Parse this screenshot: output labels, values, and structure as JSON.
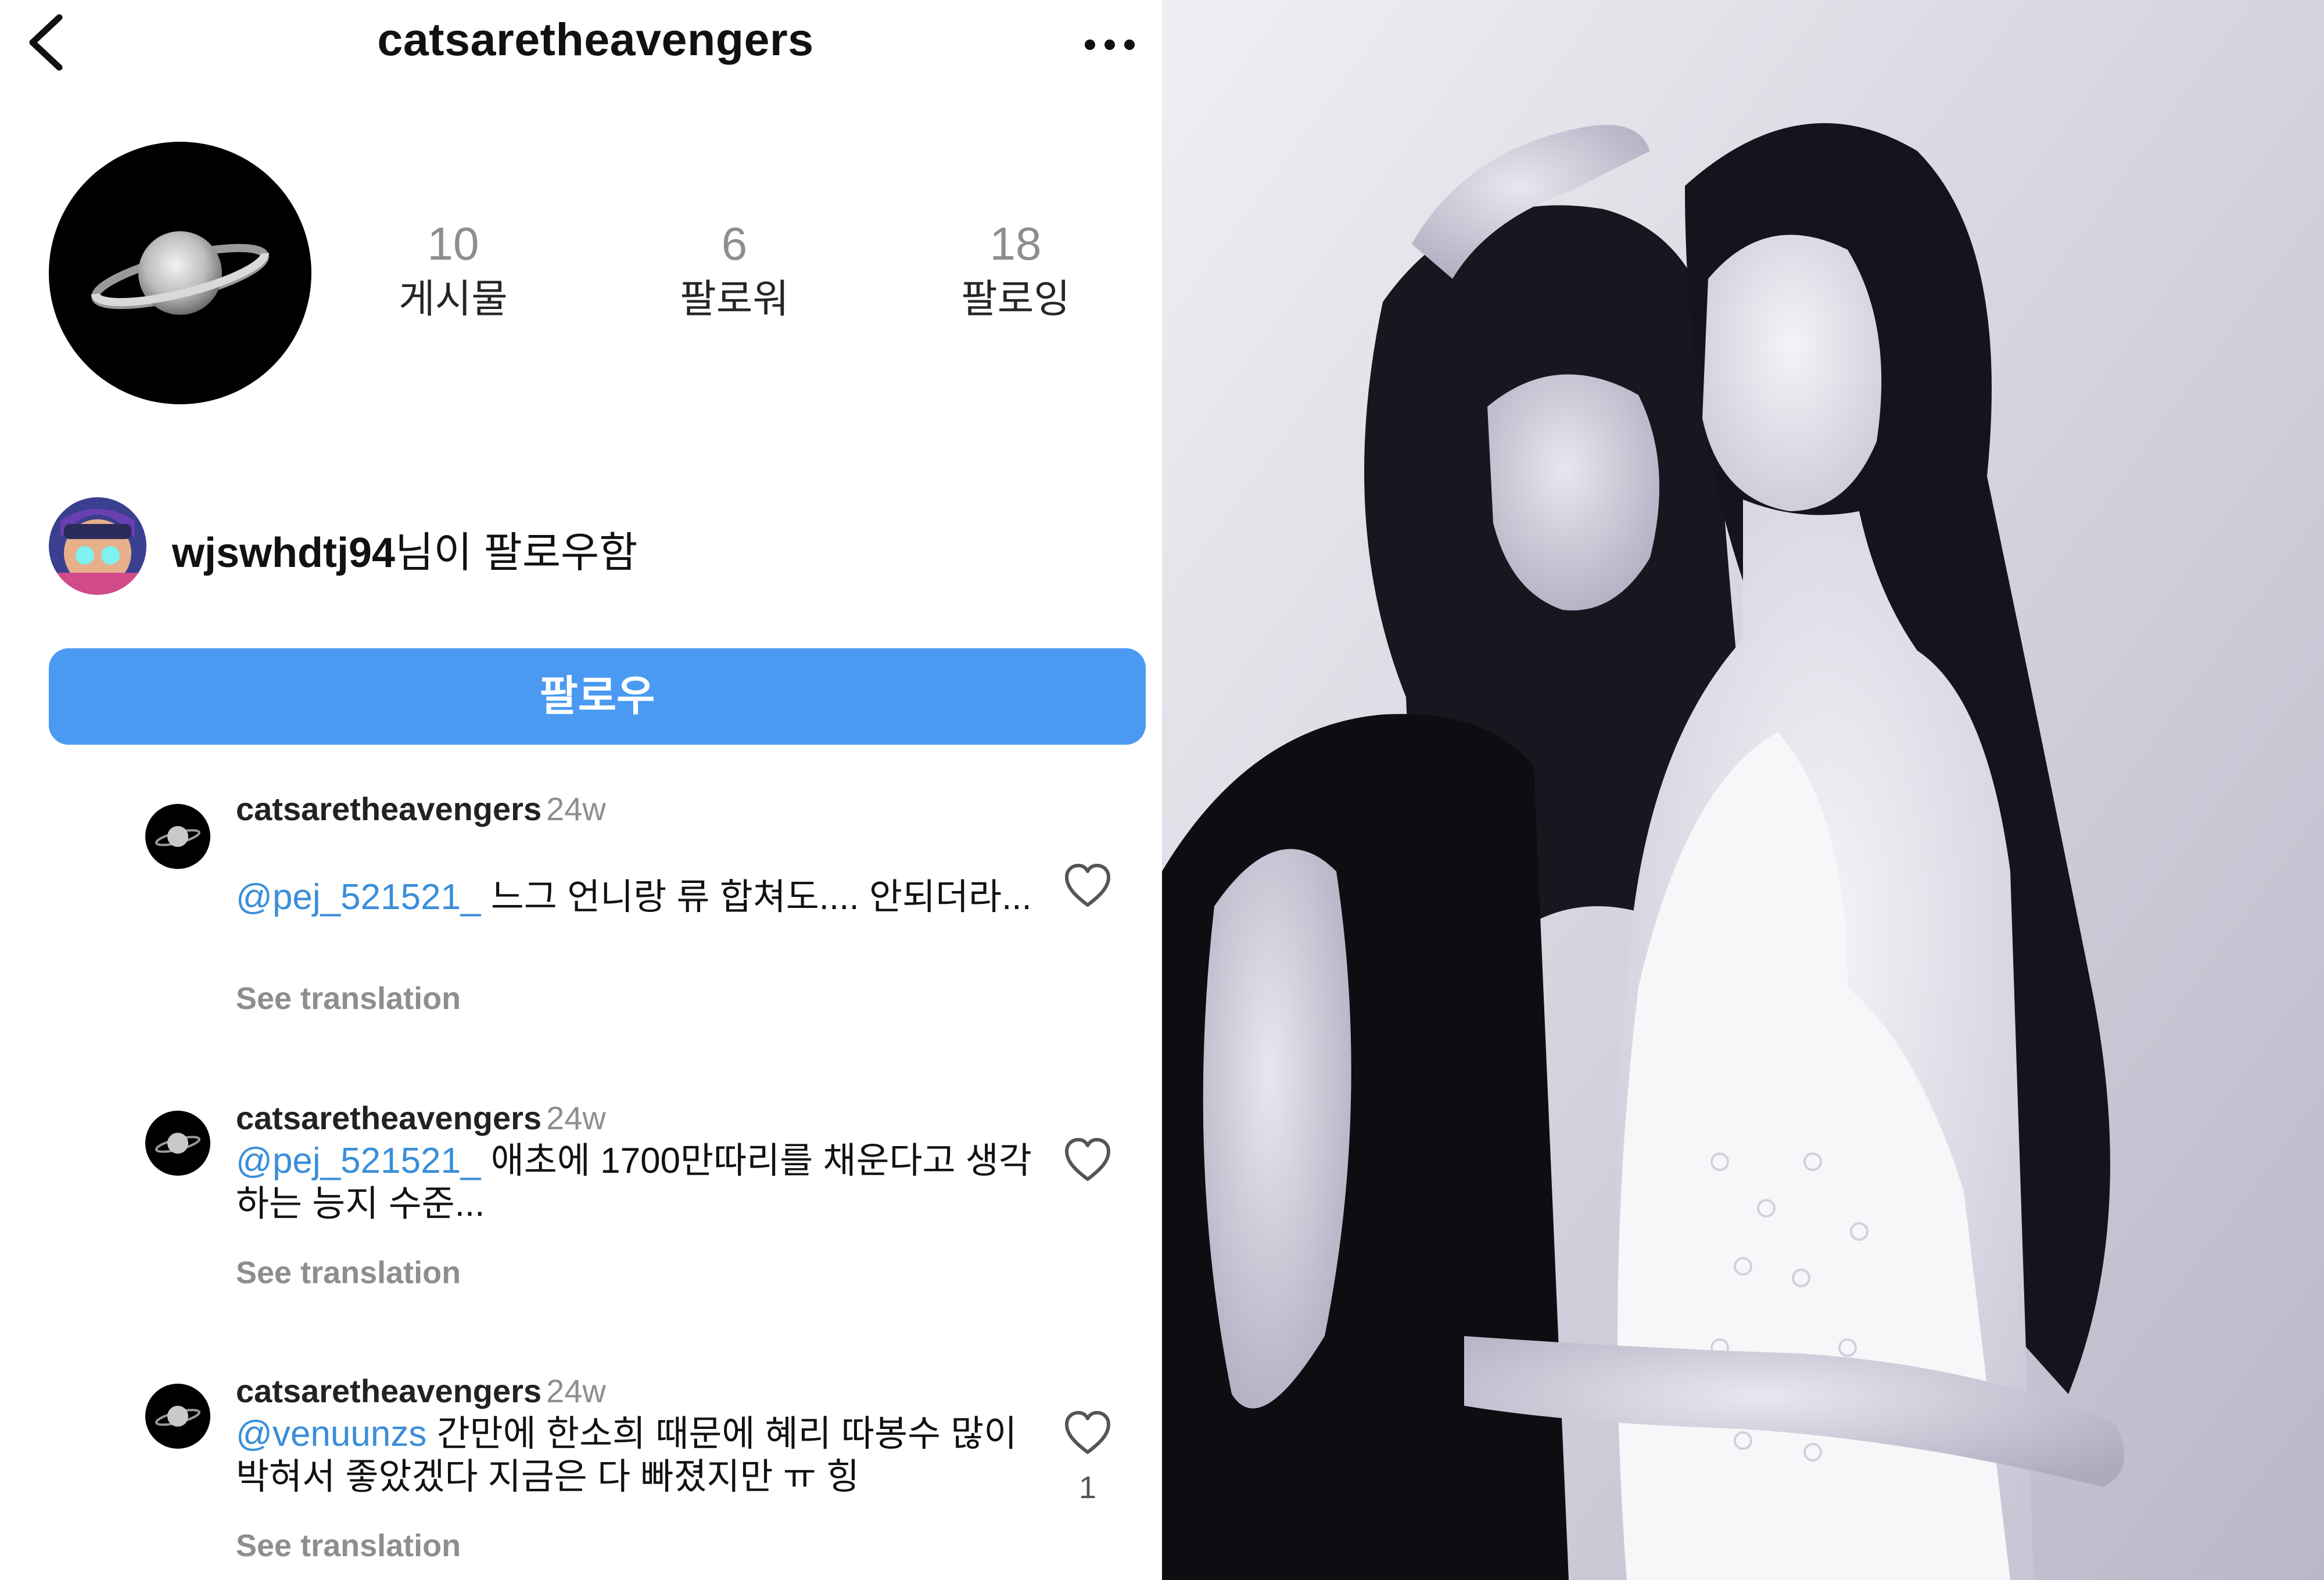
{
  "header": {
    "title": "catsaretheavengers",
    "back_icon": "chevron-left-icon",
    "more_icon": "more-horizontal-icon"
  },
  "profile": {
    "avatar_icon": "saturn-planet-icon",
    "stats": [
      {
        "value": "10",
        "label": "게시물"
      },
      {
        "value": "6",
        "label": "팔로워"
      },
      {
        "value": "18",
        "label": "팔로잉"
      }
    ]
  },
  "followed_by": {
    "username": "wjswhdtj94",
    "suffix": "님이 팔로우함"
  },
  "follow_button": {
    "label": "팔로우"
  },
  "comments": [
    {
      "username": "catsaretheavengers",
      "time": "24w",
      "mention": "@pej_521521_",
      "text": " 느그 언니랑 류 합쳐도.... 안되더라...",
      "translate": "See translation",
      "likes": ""
    },
    {
      "username": "catsaretheavengers",
      "time": "24w",
      "mention": "@pej_521521_",
      "text": " 애초에 1700만따리를 채운다고 생각하는 능지 수준...",
      "translate": "See translation",
      "likes": ""
    },
    {
      "username": "catsaretheavengers",
      "time": "24w",
      "mention": "@venuunzs",
      "text": " 간만에 한소희 때문에 혜리 따봉수 많이 박혀서 좋았겠다 지금은 다 빠졌지만 ㅠ 힝",
      "translate": "See translation",
      "likes": "1"
    }
  ],
  "colors": {
    "follow_button": "#4a9af2",
    "mention": "#3b8ed9",
    "muted_text": "#8e8e8e",
    "photo_tint": "#e9e9ee"
  }
}
